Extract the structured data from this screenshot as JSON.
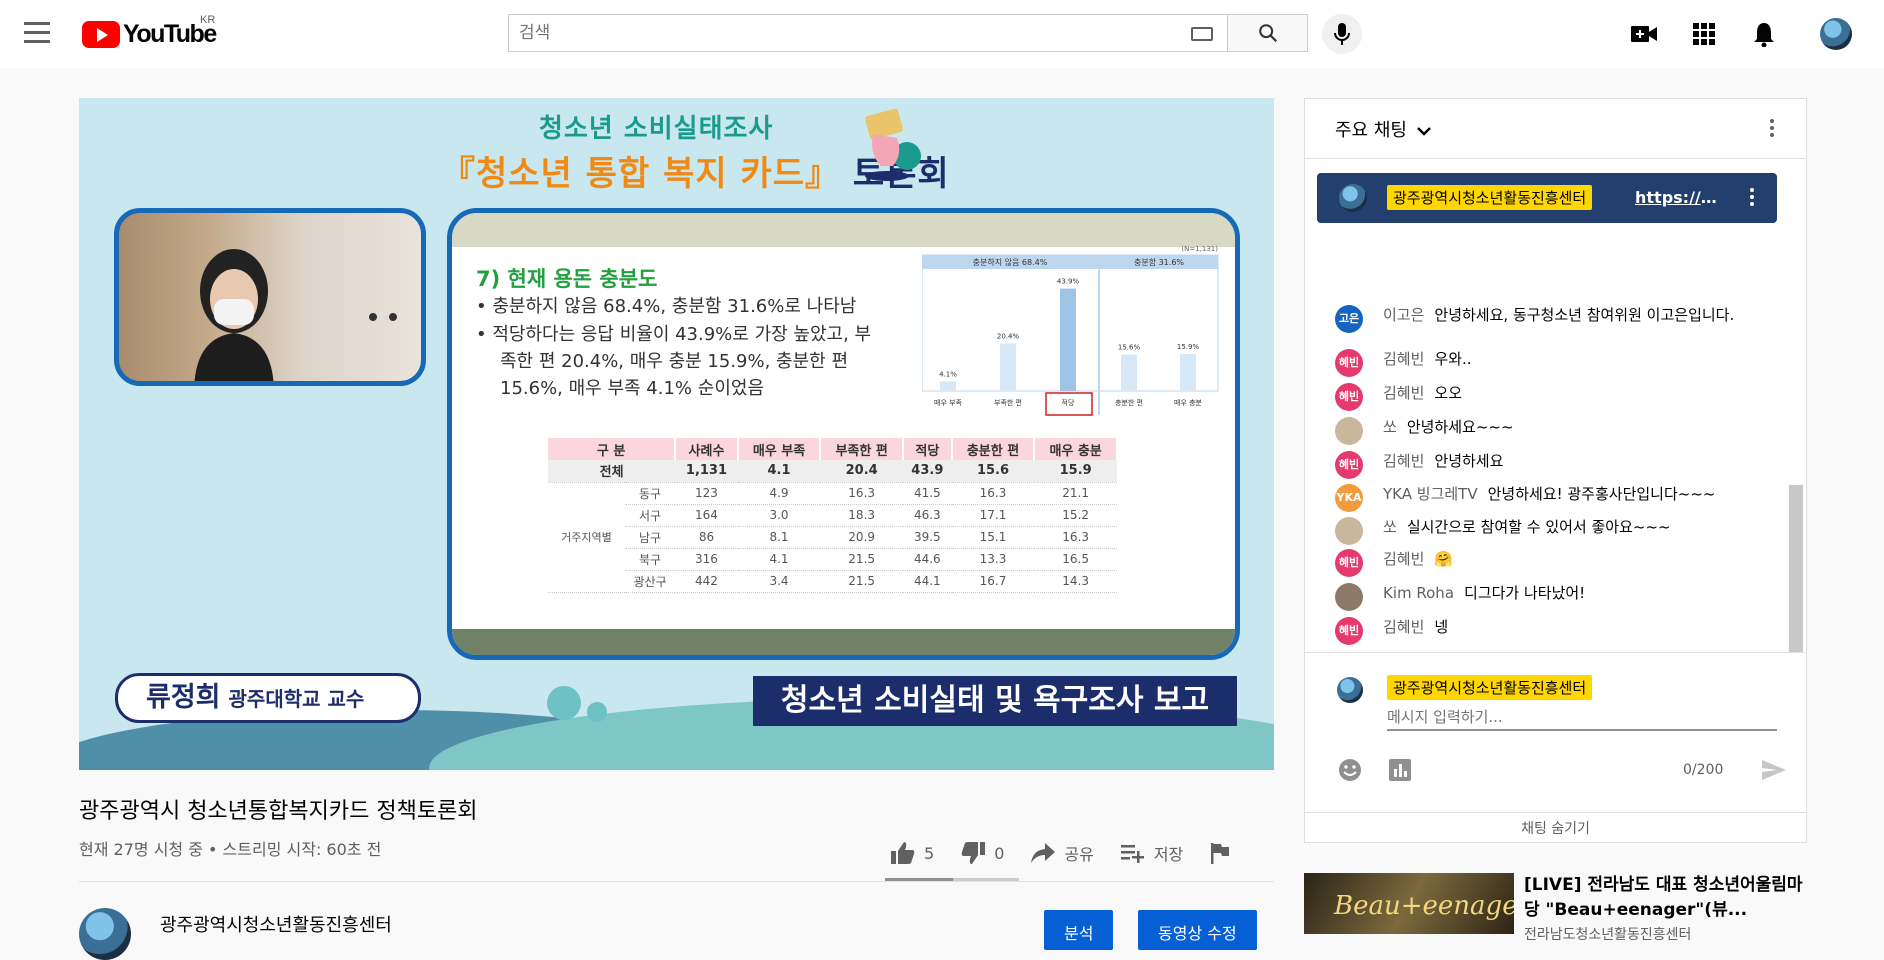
{
  "masthead": {
    "logo_text": "YouTube",
    "country_code": "KR",
    "search_placeholder": "검색"
  },
  "player": {
    "title_line1": "청소년 소비실태조사",
    "title_line2_prefix": "『청소년 통합 복지 카드』",
    "title_line2_suffix": "토론회",
    "slide": {
      "heading": "7) 현재 용돈 충분도",
      "bullet1": "•  충분하지 않음 68.4%, 충분함 31.6%로 나타남",
      "bullet2a": "•  적당하다는 응답 비율이 43.9%로 가장 높았고, 부",
      "bullet2b": "족한 편 20.4%, 매우 충분 15.9%, 충분한 편",
      "bullet2c": "15.6%, 매우 부족 4.1% 순이었음",
      "chart_note": "(N=1,131)",
      "chart_group1": "충분하지 않음 68.4%",
      "chart_group2": "충분함 31.6%",
      "chart_values": [
        4.1,
        20.4,
        43.9,
        15.6,
        15.9
      ],
      "chart_value_labels": [
        "4.1%",
        "20.4%",
        "43.9%",
        "15.6%",
        "15.9%"
      ],
      "chart_categories": [
        "매우 부족",
        "부족한 편",
        "적당",
        "충분한 편",
        "매우 충분"
      ],
      "table_headers": [
        "구 분",
        "사례수",
        "매우 부족",
        "부족한 편",
        "적당",
        "충분한 편",
        "매우 충분"
      ],
      "table_total": [
        "전체",
        "1,131",
        "4.1",
        "20.4",
        "43.9",
        "15.6",
        "15.9"
      ],
      "table_group_label": "거주지역별",
      "table_rows": [
        [
          "동구",
          "123",
          "4.9",
          "16.3",
          "41.5",
          "16.3",
          "21.1"
        ],
        [
          "서구",
          "164",
          "3.0",
          "18.3",
          "46.3",
          "17.1",
          "15.2"
        ],
        [
          "남구",
          "86",
          "8.1",
          "20.9",
          "39.5",
          "15.1",
          "16.3"
        ],
        [
          "북구",
          "316",
          "4.1",
          "21.5",
          "44.6",
          "13.3",
          "16.5"
        ],
        [
          "광산구",
          "442",
          "3.4",
          "21.5",
          "44.1",
          "16.7",
          "14.3"
        ]
      ]
    },
    "speaker_name": "류정희",
    "speaker_role": "광주대학교 교수",
    "report_banner": "청소년 소비실태 및 욕구조사 보고"
  },
  "video": {
    "title": "광주광역시 청소년통합복지카드 정책토론회",
    "meta": "현재 27명 시청 중 • 스트리밍 시작: 60초 전",
    "likes": "5",
    "dislikes": "0",
    "share_label": "공유",
    "save_label": "저장",
    "channel_name": "광주광역시청소년활동진흥센터",
    "analytics_label": "분석",
    "edit_label": "동영상 수정"
  },
  "chat": {
    "header": "주요 채팅",
    "pinned_author": "광주광역시청소년활동진흥센터",
    "pinned_link": "https://c1...",
    "messages": [
      {
        "author": "이고은",
        "text": "안녕하세요, 동구청소년 참여위원 이고은입니다.",
        "avatar": "고은",
        "color": "#1565c0"
      },
      {
        "author": "김혜빈",
        "text": "우와..",
        "avatar": "혜빈",
        "color": "#e53a6d"
      },
      {
        "author": "김혜빈",
        "text": "오오",
        "avatar": "혜빈",
        "color": "#e53a6d"
      },
      {
        "author": "쏘",
        "text": "안녕하세요~~~",
        "avatar": "",
        "color": "#c9b79c"
      },
      {
        "author": "김혜빈",
        "text": "안녕하세요",
        "avatar": "혜빈",
        "color": "#e53a6d"
      },
      {
        "author": "YKA 빙그레TV",
        "text": "안녕하세요! 광주홍사단입니다~~~",
        "avatar": "YKA",
        "color": "#f39a3d"
      },
      {
        "author": "쏘",
        "text": "실시간으로 참여할 수 있어서 좋아요~~~",
        "avatar": "",
        "color": "#c9b79c"
      },
      {
        "author": "김혜빈",
        "text": "🤗",
        "avatar": "혜빈",
        "color": "#e53a6d"
      },
      {
        "author": "Kim Roha",
        "text": "디그다가 나타났어!",
        "avatar": "",
        "color": "#8a7a66"
      },
      {
        "author": "김혜빈",
        "text": "넹",
        "avatar": "혜빈",
        "color": "#e53a6d"
      }
    ],
    "input_author": "광주광역시청소년활동진흥센터",
    "input_placeholder": "메시지 입력하기...",
    "char_count": "0/200",
    "hide_label": "채팅 숨기기"
  },
  "recommendation": {
    "thumb_text": "Beau+eenager",
    "title": "[LIVE] 전라남도 대표 청소년어울림마당 \"Beau+eenager\"(뷰...",
    "channel": "전라남도청소년활동진흥센터"
  }
}
